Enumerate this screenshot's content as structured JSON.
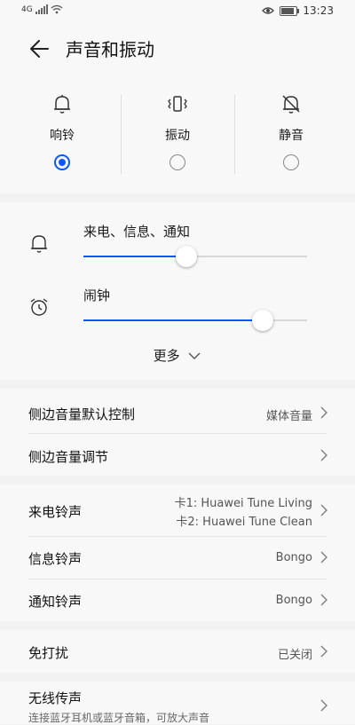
{
  "status": {
    "network": "4G",
    "time": "13:23"
  },
  "header": {
    "title": "声音和振动"
  },
  "modes": [
    {
      "label": "响铃",
      "icon": "bell-icon",
      "selected": true
    },
    {
      "label": "振动",
      "icon": "vibrate-icon",
      "selected": false
    },
    {
      "label": "静音",
      "icon": "bell-off-icon",
      "selected": false
    }
  ],
  "volume": {
    "items": [
      {
        "label": "来电、信息、通知",
        "icon": "bell-icon",
        "level": 0.46
      },
      {
        "label": "闹钟",
        "icon": "alarm-clock-icon",
        "level": 0.8
      }
    ],
    "more_label": "更多"
  },
  "settings": {
    "side_control": {
      "label": "侧边音量默认控制",
      "value": "媒体音量"
    },
    "side_adjust": {
      "label": "侧边音量调节"
    },
    "ringtone": {
      "label": "来电铃声",
      "sim1": "卡1: Huawei Tune Living",
      "sim2": "卡2: Huawei Tune Clean"
    },
    "message_tone": {
      "label": "信息铃声",
      "value": "Bongo"
    },
    "notify_tone": {
      "label": "通知铃声",
      "value": "Bongo"
    },
    "dnd": {
      "label": "免打扰",
      "value": "已关闭"
    },
    "wireless": {
      "label": "无线传声",
      "desc": "连接蓝牙耳机或蓝牙音箱，可放大声音"
    }
  },
  "colors": {
    "accent": "#0a59f7",
    "background": "#f2f2f2",
    "card": "#f8f8f8"
  }
}
